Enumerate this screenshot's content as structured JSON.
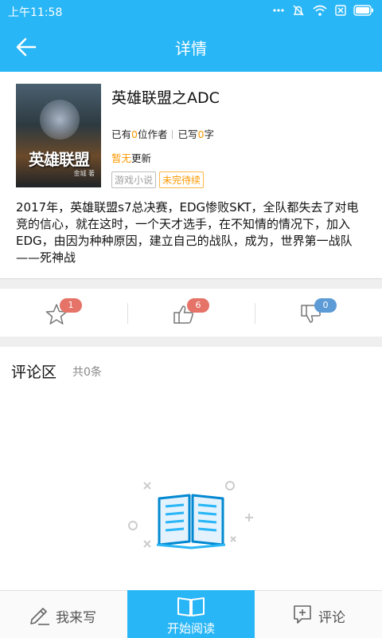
{
  "status_bar": {
    "time": "上午11:58",
    "icons": [
      "more-dots-icon",
      "alarm-off-icon",
      "wifi-icon",
      "sim-icon",
      "battery-icon"
    ]
  },
  "app_bar": {
    "title": "详情",
    "back_icon": "arrow-left-icon"
  },
  "book": {
    "cover_title": "英雄联盟",
    "cover_author": "金城 著",
    "title": "英雄联盟之ADC",
    "authors_prefix": "已有",
    "authors_count": "0",
    "authors_suffix": "位作者",
    "words_prefix": "已写",
    "words_count": "0",
    "words_suffix": "字",
    "update_highlight": "暂无",
    "update_suffix": "更新",
    "tags": [
      "游戏小说",
      "未完待续"
    ],
    "description": "2017年，英雄联盟s7总决赛，EDG惨败SKT，全队都失去了对电竞的信心，就在这时，一个天才选手，在不知情的情况下，加入EDG，由因为种种原因，建立自己的战队，成为，世界第一战队——死神战"
  },
  "actions": {
    "favorite": {
      "icon": "star-icon",
      "count": "1"
    },
    "like": {
      "icon": "thumbs-up-icon",
      "count": "6"
    },
    "dislike": {
      "icon": "thumbs-down-icon",
      "count": "0"
    }
  },
  "comments": {
    "title": "评论区",
    "count_text": "共0条",
    "empty_icon": "open-book-icon"
  },
  "bottom_bar": {
    "write_label": "我来写",
    "read_label": "开始阅读",
    "comment_label": "评论"
  },
  "colors": {
    "primary": "#29b6f6",
    "accent_orange": "#ff9800",
    "badge_red": "#e57368",
    "badge_blue": "#5c9bd6"
  }
}
